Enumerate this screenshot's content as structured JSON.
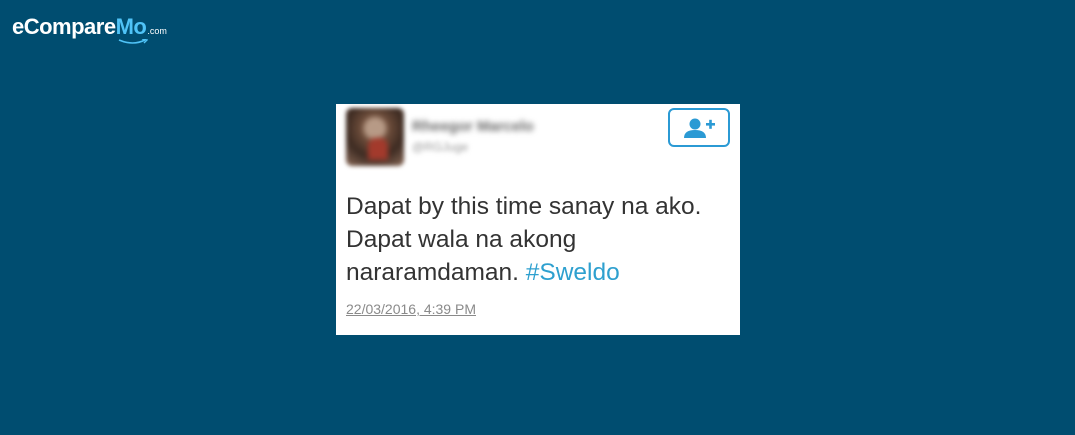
{
  "brand": {
    "logo_main": "eCompare",
    "logo_accent": "Mo",
    "logo_suffix": ".com"
  },
  "tweet": {
    "author_name": "Rheegor Marcelo",
    "author_handle": "@RGJuge",
    "text_main": "Dapat by this time sanay na ako. Dapat wala na akong nararamdaman.",
    "hashtag": "#Sweldo",
    "timestamp": "22/03/2016, 4:39 PM",
    "follow_icon": "add-user-icon"
  },
  "colors": {
    "background": "#004d70",
    "card": "#ffffff",
    "accent": "#2b9ad4",
    "hashtag": "#2ea0cf"
  }
}
